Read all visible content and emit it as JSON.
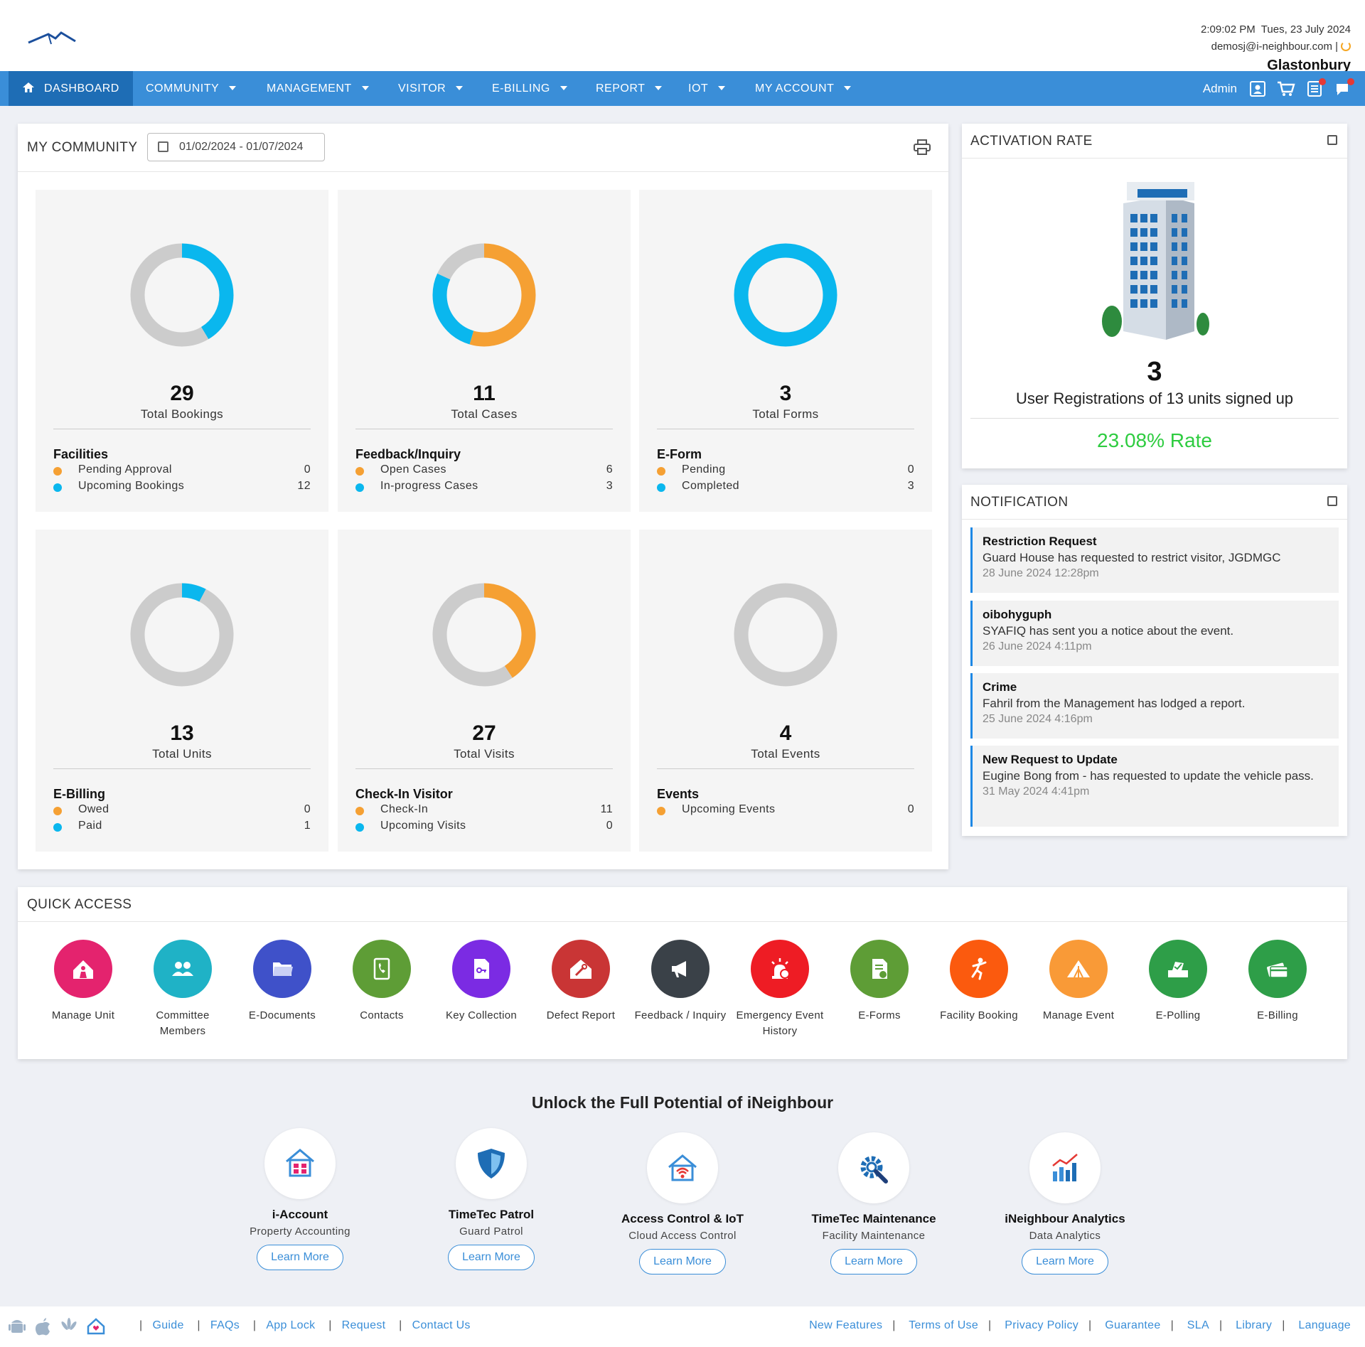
{
  "header": {
    "datetime": "2:09:02 PM  Tues, 23 July 2024",
    "email": "demosj@i-neighbour.com |",
    "location": "Glastonbury"
  },
  "nav": {
    "items": [
      "DASHBOARD",
      "COMMUNITY",
      "MANAGEMENT",
      "VISITOR",
      "E-BILLING",
      "REPORT",
      "IOT",
      "MY ACCOUNT"
    ],
    "user": "Admin"
  },
  "colors": {
    "orange": "#f5a033",
    "blue": "#0ab7ee",
    "grey": "#cccccc",
    "nav": "#3a8ed8",
    "rate": "#2ecc40"
  },
  "community": {
    "title": "MY COMMUNITY",
    "date_range": "01/02/2024 - 01/07/2024",
    "stats": [
      {
        "total": "29",
        "label": "Total Bookings",
        "section": "Facilities",
        "rows": [
          {
            "label": "Pending Approval",
            "value": "0",
            "color": "orange"
          },
          {
            "label": "Upcoming Bookings",
            "value": "12",
            "color": "blue"
          }
        ],
        "segments": [
          {
            "color": "blue",
            "fraction": 0.4138
          },
          {
            "color": "grey",
            "fraction": 0.5862
          }
        ]
      },
      {
        "total": "11",
        "label": "Total Cases",
        "section": "Feedback/Inquiry",
        "rows": [
          {
            "label": "Open Cases",
            "value": "6",
            "color": "orange"
          },
          {
            "label": "In-progress Cases",
            "value": "3",
            "color": "blue"
          }
        ],
        "segments": [
          {
            "color": "orange",
            "fraction": 0.5455
          },
          {
            "color": "blue",
            "fraction": 0.2727
          },
          {
            "color": "grey",
            "fraction": 0.1818
          }
        ]
      },
      {
        "total": "3",
        "label": "Total Forms",
        "section": "E-Form",
        "rows": [
          {
            "label": "Pending",
            "value": "0",
            "color": "orange"
          },
          {
            "label": "Completed",
            "value": "3",
            "color": "blue"
          }
        ],
        "segments": [
          {
            "color": "blue",
            "fraction": 1
          }
        ]
      },
      {
        "total": "13",
        "label": "Total Units",
        "section": "E-Billing",
        "rows": [
          {
            "label": "Owed",
            "value": "0",
            "color": "orange"
          },
          {
            "label": "Paid",
            "value": "1",
            "color": "blue"
          }
        ],
        "segments": [
          {
            "color": "blue",
            "fraction": 0.0769
          },
          {
            "color": "grey",
            "fraction": 0.9231
          }
        ]
      },
      {
        "total": "27",
        "label": "Total Visits",
        "section": "Check-In Visitor",
        "rows": [
          {
            "label": "Check-In",
            "value": "11",
            "color": "orange"
          },
          {
            "label": "Upcoming Visits",
            "value": "0",
            "color": "blue"
          }
        ],
        "segments": [
          {
            "color": "orange",
            "fraction": 0.4074
          },
          {
            "color": "grey",
            "fraction": 0.5926
          }
        ]
      },
      {
        "total": "4",
        "label": "Total Events",
        "section": "Events",
        "rows": [
          {
            "label": "Upcoming Events",
            "value": "0",
            "color": "orange"
          }
        ],
        "segments": [
          {
            "color": "grey",
            "fraction": 1
          }
        ]
      }
    ]
  },
  "activation": {
    "title": "ACTIVATION RATE",
    "count": "3",
    "text": "User Registrations of 13 units signed up",
    "rate": "23.08% Rate"
  },
  "notification": {
    "title": "NOTIFICATION",
    "items": [
      {
        "title": "Restriction Request",
        "body": "Guard House has requested to restrict visitor, JGDMGC",
        "date": "28 June 2024 12:28pm"
      },
      {
        "title": "oibohyguph",
        "body": "SYAFIQ has sent you a notice about the event.",
        "date": "26 June 2024 4:11pm"
      },
      {
        "title": "Crime",
        "body": "Fahril from the Management has lodged a report.",
        "date": "25 June 2024 4:16pm"
      },
      {
        "title": "New Request to Update",
        "body": "Eugine Bong from - has requested to update the vehicle pass.",
        "date": "31 May 2024 4:41pm"
      }
    ]
  },
  "quick_access": {
    "title": "QUICK ACCESS",
    "items": [
      {
        "label": "Manage Unit",
        "color": "#e4236e",
        "icon": "house-person-icon"
      },
      {
        "label": "Committee Members",
        "color": "#1fb2c6",
        "icon": "people-icon"
      },
      {
        "label": "E-Documents",
        "color": "#3f51c9",
        "icon": "folder-icon"
      },
      {
        "label": "Contacts",
        "color": "#5e9d36",
        "icon": "phonebook-icon"
      },
      {
        "label": "Key Collection",
        "color": "#7b2be3",
        "icon": "key-doc-icon"
      },
      {
        "label": "Defect Report",
        "color": "#c93535",
        "icon": "house-wrench-icon"
      },
      {
        "label": "Feedback / Inquiry",
        "color": "#3a4148",
        "icon": "megaphone-icon"
      },
      {
        "label": "Emergency Event History",
        "color": "#ee1c24",
        "icon": "siren-icon"
      },
      {
        "label": "E-Forms",
        "color": "#5e9d36",
        "icon": "form-icon"
      },
      {
        "label": "Facility Booking",
        "color": "#fb5a0e",
        "icon": "runner-icon"
      },
      {
        "label": "Manage Event",
        "color": "#f99a37",
        "icon": "tent-icon"
      },
      {
        "label": "E-Polling",
        "color": "#2e9e48",
        "icon": "vote-icon"
      },
      {
        "label": "E-Billing",
        "color": "#2e9e48",
        "icon": "card-icon"
      }
    ]
  },
  "promo": {
    "title": "Unlock the Full Potential of iNeighbour",
    "learn": "Learn More",
    "items": [
      {
        "name": "i-Account",
        "sub": "Property Accounting",
        "icon": "house-grid-icon"
      },
      {
        "name": "TimeTec Patrol",
        "sub": "Guard Patrol",
        "icon": "shield-icon"
      },
      {
        "name": "Access Control & IoT",
        "sub": "Cloud Access Control",
        "icon": "house-wifi-icon"
      },
      {
        "name": "TimeTec Maintenance",
        "sub": "Facility Maintenance",
        "icon": "gear-wrench-icon"
      },
      {
        "name": "iNeighbour Analytics",
        "sub": "Data Analytics",
        "icon": "chart-icon"
      }
    ]
  },
  "footer": {
    "left": [
      "Guide",
      "FAQs",
      "App Lock",
      "Request",
      "Contact Us"
    ],
    "right": [
      "New Features",
      "Terms of Use",
      "Privacy Policy",
      "Guarantee",
      "SLA",
      "Library",
      "Language"
    ]
  }
}
